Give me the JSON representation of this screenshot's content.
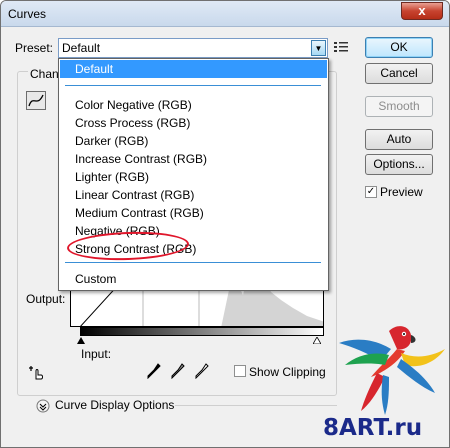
{
  "window": {
    "title": "Curves",
    "close_label": "x"
  },
  "preset": {
    "label": "Preset:",
    "value": "Default",
    "options": [
      "Default",
      "Color Negative (RGB)",
      "Cross Process (RGB)",
      "Darker (RGB)",
      "Increase Contrast (RGB)",
      "Lighter (RGB)",
      "Linear Contrast (RGB)",
      "Medium Contrast (RGB)",
      "Negative (RGB)",
      "Strong Contrast (RGB)",
      "Custom"
    ],
    "highlighted": "Strong Contrast (RGB)"
  },
  "buttons": {
    "ok": "OK",
    "cancel": "Cancel",
    "smooth": "Smooth",
    "auto": "Auto",
    "options": "Options..."
  },
  "preview": {
    "label": "Preview",
    "checked": true
  },
  "channel_group": {
    "title": "Chann"
  },
  "graph": {
    "output_label": "Output:",
    "input_label": "Input:"
  },
  "clipping": {
    "label": "Show Clipping",
    "checked": false
  },
  "curve_display": {
    "label": "Curve Display Options"
  },
  "watermark": {
    "text": "8ART.ru"
  },
  "colors": {
    "selection": "#3399ff",
    "annotation": "#e0162b",
    "accent": "#3c7fb1"
  }
}
